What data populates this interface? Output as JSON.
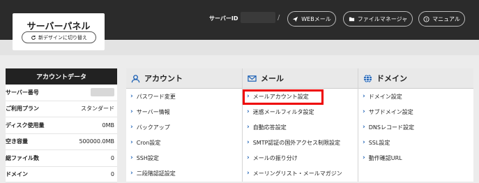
{
  "header": {
    "logo_title": "サーバーパネル",
    "switch_label": "新デザインに切り替え",
    "server_id_label": "サーバーID",
    "separator": "/",
    "buttons": [
      {
        "label": "WEBメール",
        "icon": "send-icon"
      },
      {
        "label": "ファイルマネージャ",
        "icon": "folder-icon"
      },
      {
        "label": "マニュアル",
        "icon": "help-icon"
      }
    ]
  },
  "account_data": {
    "title": "アカウントデータ",
    "rows": [
      {
        "key": "サーバー番号",
        "value": ""
      },
      {
        "key": "ご利用プラン",
        "value": "スタンダード"
      },
      {
        "key": "ディスク使用量",
        "value": "0MB"
      },
      {
        "key": "空き容量",
        "value": "500000.0MB"
      },
      {
        "key": "総ファイル数",
        "value": "0"
      },
      {
        "key": "ドメイン",
        "value": "0"
      }
    ]
  },
  "sections": [
    {
      "title": "アカウント",
      "icon": "user-icon",
      "links": [
        "パスワード変更",
        "サーバー情報",
        "バックアップ",
        "Cron設定",
        "SSH設定",
        "二段階認証設定"
      ]
    },
    {
      "title": "メール",
      "icon": "mail-icon",
      "links": [
        "メールアカウント設定",
        "迷惑メールフィルタ設定",
        "自動応答設定",
        "SMTP認証の国外アクセス制限設定",
        "メールの振り分け",
        "メーリングリスト・メールマガジン"
      ]
    },
    {
      "title": "ドメイン",
      "icon": "globe-icon",
      "links": [
        "ドメイン設定",
        "サブドメイン設定",
        "DNSレコード設定",
        "SSL設定",
        "動作確認URL"
      ]
    }
  ],
  "colors": {
    "topbar": "#2b2b2b",
    "highlight": "#e00000",
    "link_chevron": "#1a5fb4"
  }
}
